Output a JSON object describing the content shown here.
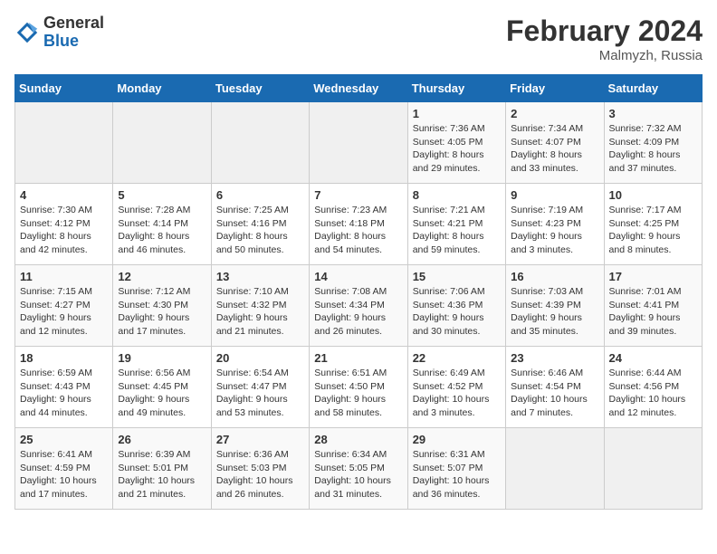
{
  "header": {
    "logo_general": "General",
    "logo_blue": "Blue",
    "month_year": "February 2024",
    "location": "Malmyzh, Russia"
  },
  "days_of_week": [
    "Sunday",
    "Monday",
    "Tuesday",
    "Wednesday",
    "Thursday",
    "Friday",
    "Saturday"
  ],
  "weeks": [
    [
      {
        "day": "",
        "info": ""
      },
      {
        "day": "",
        "info": ""
      },
      {
        "day": "",
        "info": ""
      },
      {
        "day": "",
        "info": ""
      },
      {
        "day": "1",
        "info": "Sunrise: 7:36 AM\nSunset: 4:05 PM\nDaylight: 8 hours\nand 29 minutes."
      },
      {
        "day": "2",
        "info": "Sunrise: 7:34 AM\nSunset: 4:07 PM\nDaylight: 8 hours\nand 33 minutes."
      },
      {
        "day": "3",
        "info": "Sunrise: 7:32 AM\nSunset: 4:09 PM\nDaylight: 8 hours\nand 37 minutes."
      }
    ],
    [
      {
        "day": "4",
        "info": "Sunrise: 7:30 AM\nSunset: 4:12 PM\nDaylight: 8 hours\nand 42 minutes."
      },
      {
        "day": "5",
        "info": "Sunrise: 7:28 AM\nSunset: 4:14 PM\nDaylight: 8 hours\nand 46 minutes."
      },
      {
        "day": "6",
        "info": "Sunrise: 7:25 AM\nSunset: 4:16 PM\nDaylight: 8 hours\nand 50 minutes."
      },
      {
        "day": "7",
        "info": "Sunrise: 7:23 AM\nSunset: 4:18 PM\nDaylight: 8 hours\nand 54 minutes."
      },
      {
        "day": "8",
        "info": "Sunrise: 7:21 AM\nSunset: 4:21 PM\nDaylight: 8 hours\nand 59 minutes."
      },
      {
        "day": "9",
        "info": "Sunrise: 7:19 AM\nSunset: 4:23 PM\nDaylight: 9 hours\nand 3 minutes."
      },
      {
        "day": "10",
        "info": "Sunrise: 7:17 AM\nSunset: 4:25 PM\nDaylight: 9 hours\nand 8 minutes."
      }
    ],
    [
      {
        "day": "11",
        "info": "Sunrise: 7:15 AM\nSunset: 4:27 PM\nDaylight: 9 hours\nand 12 minutes."
      },
      {
        "day": "12",
        "info": "Sunrise: 7:12 AM\nSunset: 4:30 PM\nDaylight: 9 hours\nand 17 minutes."
      },
      {
        "day": "13",
        "info": "Sunrise: 7:10 AM\nSunset: 4:32 PM\nDaylight: 9 hours\nand 21 minutes."
      },
      {
        "day": "14",
        "info": "Sunrise: 7:08 AM\nSunset: 4:34 PM\nDaylight: 9 hours\nand 26 minutes."
      },
      {
        "day": "15",
        "info": "Sunrise: 7:06 AM\nSunset: 4:36 PM\nDaylight: 9 hours\nand 30 minutes."
      },
      {
        "day": "16",
        "info": "Sunrise: 7:03 AM\nSunset: 4:39 PM\nDaylight: 9 hours\nand 35 minutes."
      },
      {
        "day": "17",
        "info": "Sunrise: 7:01 AM\nSunset: 4:41 PM\nDaylight: 9 hours\nand 39 minutes."
      }
    ],
    [
      {
        "day": "18",
        "info": "Sunrise: 6:59 AM\nSunset: 4:43 PM\nDaylight: 9 hours\nand 44 minutes."
      },
      {
        "day": "19",
        "info": "Sunrise: 6:56 AM\nSunset: 4:45 PM\nDaylight: 9 hours\nand 49 minutes."
      },
      {
        "day": "20",
        "info": "Sunrise: 6:54 AM\nSunset: 4:47 PM\nDaylight: 9 hours\nand 53 minutes."
      },
      {
        "day": "21",
        "info": "Sunrise: 6:51 AM\nSunset: 4:50 PM\nDaylight: 9 hours\nand 58 minutes."
      },
      {
        "day": "22",
        "info": "Sunrise: 6:49 AM\nSunset: 4:52 PM\nDaylight: 10 hours\nand 3 minutes."
      },
      {
        "day": "23",
        "info": "Sunrise: 6:46 AM\nSunset: 4:54 PM\nDaylight: 10 hours\nand 7 minutes."
      },
      {
        "day": "24",
        "info": "Sunrise: 6:44 AM\nSunset: 4:56 PM\nDaylight: 10 hours\nand 12 minutes."
      }
    ],
    [
      {
        "day": "25",
        "info": "Sunrise: 6:41 AM\nSunset: 4:59 PM\nDaylight: 10 hours\nand 17 minutes."
      },
      {
        "day": "26",
        "info": "Sunrise: 6:39 AM\nSunset: 5:01 PM\nDaylight: 10 hours\nand 21 minutes."
      },
      {
        "day": "27",
        "info": "Sunrise: 6:36 AM\nSunset: 5:03 PM\nDaylight: 10 hours\nand 26 minutes."
      },
      {
        "day": "28",
        "info": "Sunrise: 6:34 AM\nSunset: 5:05 PM\nDaylight: 10 hours\nand 31 minutes."
      },
      {
        "day": "29",
        "info": "Sunrise: 6:31 AM\nSunset: 5:07 PM\nDaylight: 10 hours\nand 36 minutes."
      },
      {
        "day": "",
        "info": ""
      },
      {
        "day": "",
        "info": ""
      }
    ]
  ]
}
